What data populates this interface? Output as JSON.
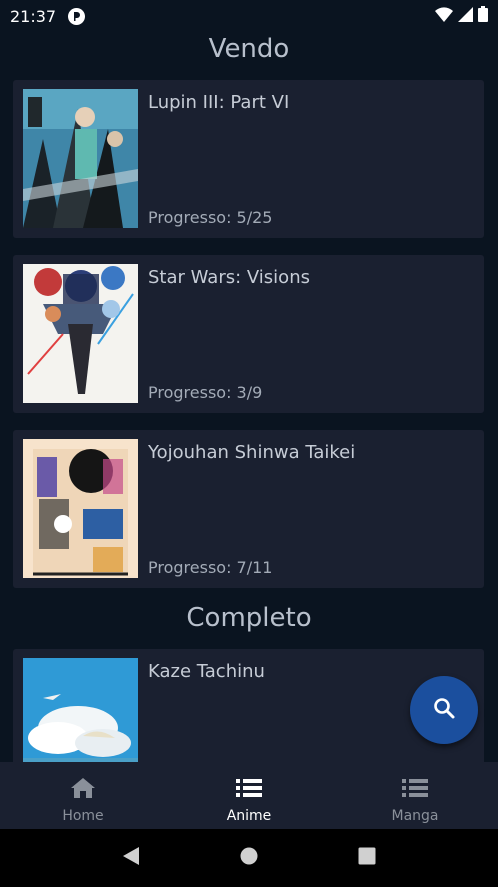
{
  "status_bar": {
    "time": "21:37"
  },
  "sections": [
    {
      "title": "Vendo",
      "items": [
        {
          "title": "Lupin III: Part VI",
          "progress": "Progresso: 5/25"
        },
        {
          "title": "Star Wars: Visions",
          "progress": "Progresso: 3/9"
        },
        {
          "title": "Yojouhan Shinwa Taikei",
          "progress": "Progresso: 7/11"
        }
      ]
    },
    {
      "title": "Completo",
      "items": [
        {
          "title": "Kaze Tachinu"
        }
      ]
    }
  ],
  "bottom_nav": {
    "items": [
      {
        "label": "Home",
        "icon": "home-icon"
      },
      {
        "label": "Anime",
        "icon": "list-icon",
        "active": true
      },
      {
        "label": "Manga",
        "icon": "list-icon"
      }
    ]
  },
  "fab": {
    "icon": "search-icon"
  },
  "colors": {
    "background": "#0a1420",
    "card": "#1a2030",
    "fab": "#1b4f9e",
    "nav_active": "#ffffff",
    "nav_inactive": "#8a909a"
  }
}
